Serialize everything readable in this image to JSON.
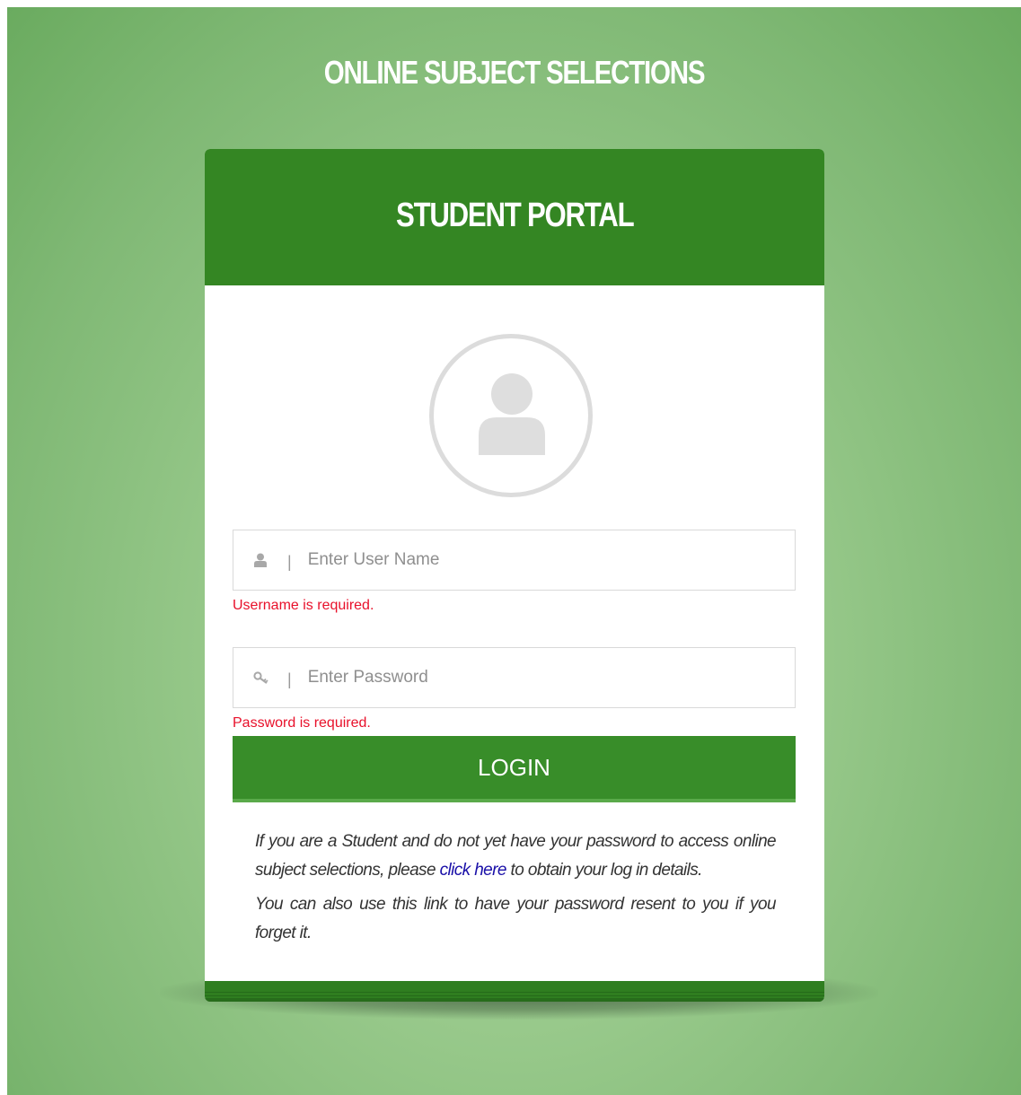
{
  "site": {
    "title": "ONLINE SUBJECT SELECTIONS"
  },
  "portal": {
    "title": "STUDENT PORTAL"
  },
  "login_form": {
    "username": {
      "placeholder": "Enter User Name",
      "value": "",
      "error": "Username is required.",
      "icon": "user-icon"
    },
    "password": {
      "placeholder": "Enter Password",
      "value": "",
      "error": "Password is required.",
      "icon": "key-icon"
    },
    "separator": "|",
    "submit_label": "LOGIN"
  },
  "info": {
    "line1_before": "If you are a Student and do not yet have your password to access online subject selections, please ",
    "link_text": "click here",
    "line1_after": " to obtain your log in details.",
    "line2": "You can also use this link to have your password resent to you if you forget it."
  },
  "colors": {
    "header_green": "#348623",
    "button_green": "#388d29",
    "error_red": "#e8102a",
    "link_blue": "#1a10a8",
    "background_green": "#98c98b"
  }
}
